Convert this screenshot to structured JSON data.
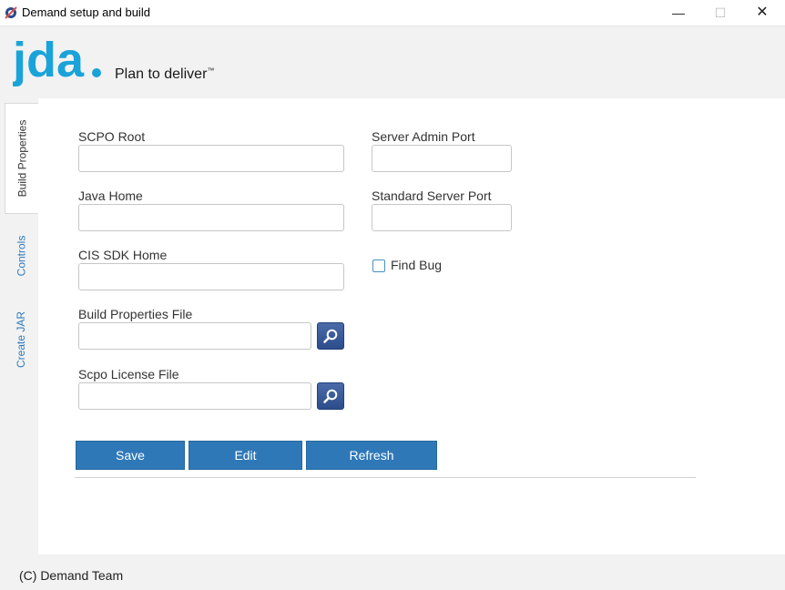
{
  "window": {
    "title": "Demand setup and build",
    "icon": "gear-app-icon",
    "controls": {
      "minimize": "—",
      "maximize": "☐",
      "close": "✕"
    }
  },
  "brand": {
    "logo_text": "jda",
    "tagline": "Plan to deliver",
    "trademark": "™",
    "color": "#1aa3d9"
  },
  "tabs": [
    {
      "label": "Build Properties",
      "active": true
    },
    {
      "label": "Controls",
      "active": false
    },
    {
      "label": "Create JAR",
      "active": false
    }
  ],
  "form": {
    "scpo_root": {
      "label": "SCPO Root",
      "value": ""
    },
    "java_home": {
      "label": "Java Home",
      "value": ""
    },
    "cis_sdk_home": {
      "label": "CIS SDK Home",
      "value": ""
    },
    "build_properties_file": {
      "label": "Build Properties File",
      "value": ""
    },
    "scpo_license_file": {
      "label": "Scpo License File",
      "value": ""
    },
    "server_admin_port": {
      "label": "Server Admin Port",
      "value": ""
    },
    "standard_server_port": {
      "label": "Standard Server Port",
      "value": ""
    },
    "find_bug": {
      "label": "Find Bug",
      "checked": false
    }
  },
  "buttons": {
    "save": "Save",
    "edit": "Edit",
    "refresh": "Refresh"
  },
  "footer": {
    "copyright": "(C) Demand Team"
  },
  "colors": {
    "accent": "#2f78b8",
    "browse_button": "#2c4d8c"
  }
}
